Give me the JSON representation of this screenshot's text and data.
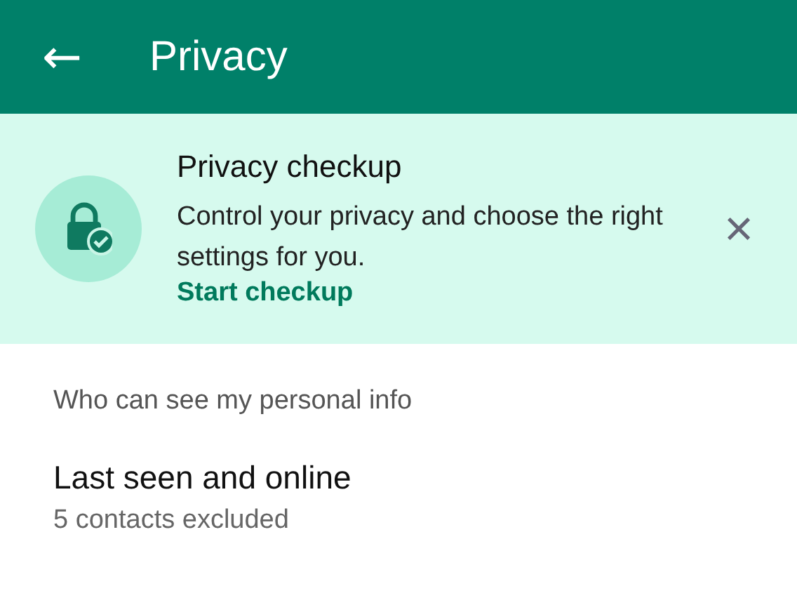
{
  "app_bar": {
    "back": "←",
    "title": "Privacy"
  },
  "checkup_card": {
    "title": "Privacy checkup",
    "description": "Control your privacy and choose the right settings for you.",
    "link": "Start checkup",
    "close": "×"
  },
  "sections": [
    {
      "header": "Who can see my personal info",
      "items": [
        {
          "title": "Last seen and online",
          "subtitle": "5 contacts excluded"
        }
      ]
    }
  ]
}
